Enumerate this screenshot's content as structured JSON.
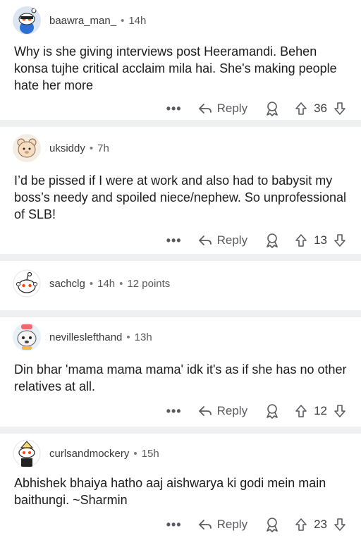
{
  "comments": [
    {
      "username": "baawra_man_",
      "time": "14h",
      "text": "Why is she giving interviews post Heeramandi. Behen konsa tujhe critical acclaim mila hai. She's making people hate her more",
      "reply_label": "Reply",
      "votes": "36",
      "more": "•••"
    },
    {
      "username": "uksiddy",
      "time": "7h",
      "text": "I’d be pissed if I were at work and also had to babysit my boss’s needy and spoiled niece/nephew. So unprofessional of SLB!",
      "reply_label": "Reply",
      "votes": "13",
      "more": "•••"
    },
    {
      "username": "sachclg",
      "time": "14h",
      "points": "12 points"
    },
    {
      "username": "nevilleslefthand",
      "time": "13h",
      "text": "Din bhar 'mama mama mama' idk it's as if she has no other relatives at all.",
      "reply_label": "Reply",
      "votes": "12",
      "more": "•••"
    },
    {
      "username": "curlsandmockery",
      "time": "15h",
      "text": "Abhishek bhaiya hatho aaj aishwarya ki godi mein main baithungi. ~Sharmin",
      "reply_label": "Reply",
      "votes": "23",
      "more": "•••"
    }
  ],
  "colors": {
    "divider": "#eef0f2",
    "meta": "#58585e",
    "text": "#1c1c1e",
    "accent_red": "#ff4500"
  },
  "icons": [
    "reply-arrow-icon",
    "award-icon",
    "upvote-arrow-icon",
    "downvote-arrow-icon",
    "more-dots-icon",
    "snoo-avatar-icon"
  ]
}
